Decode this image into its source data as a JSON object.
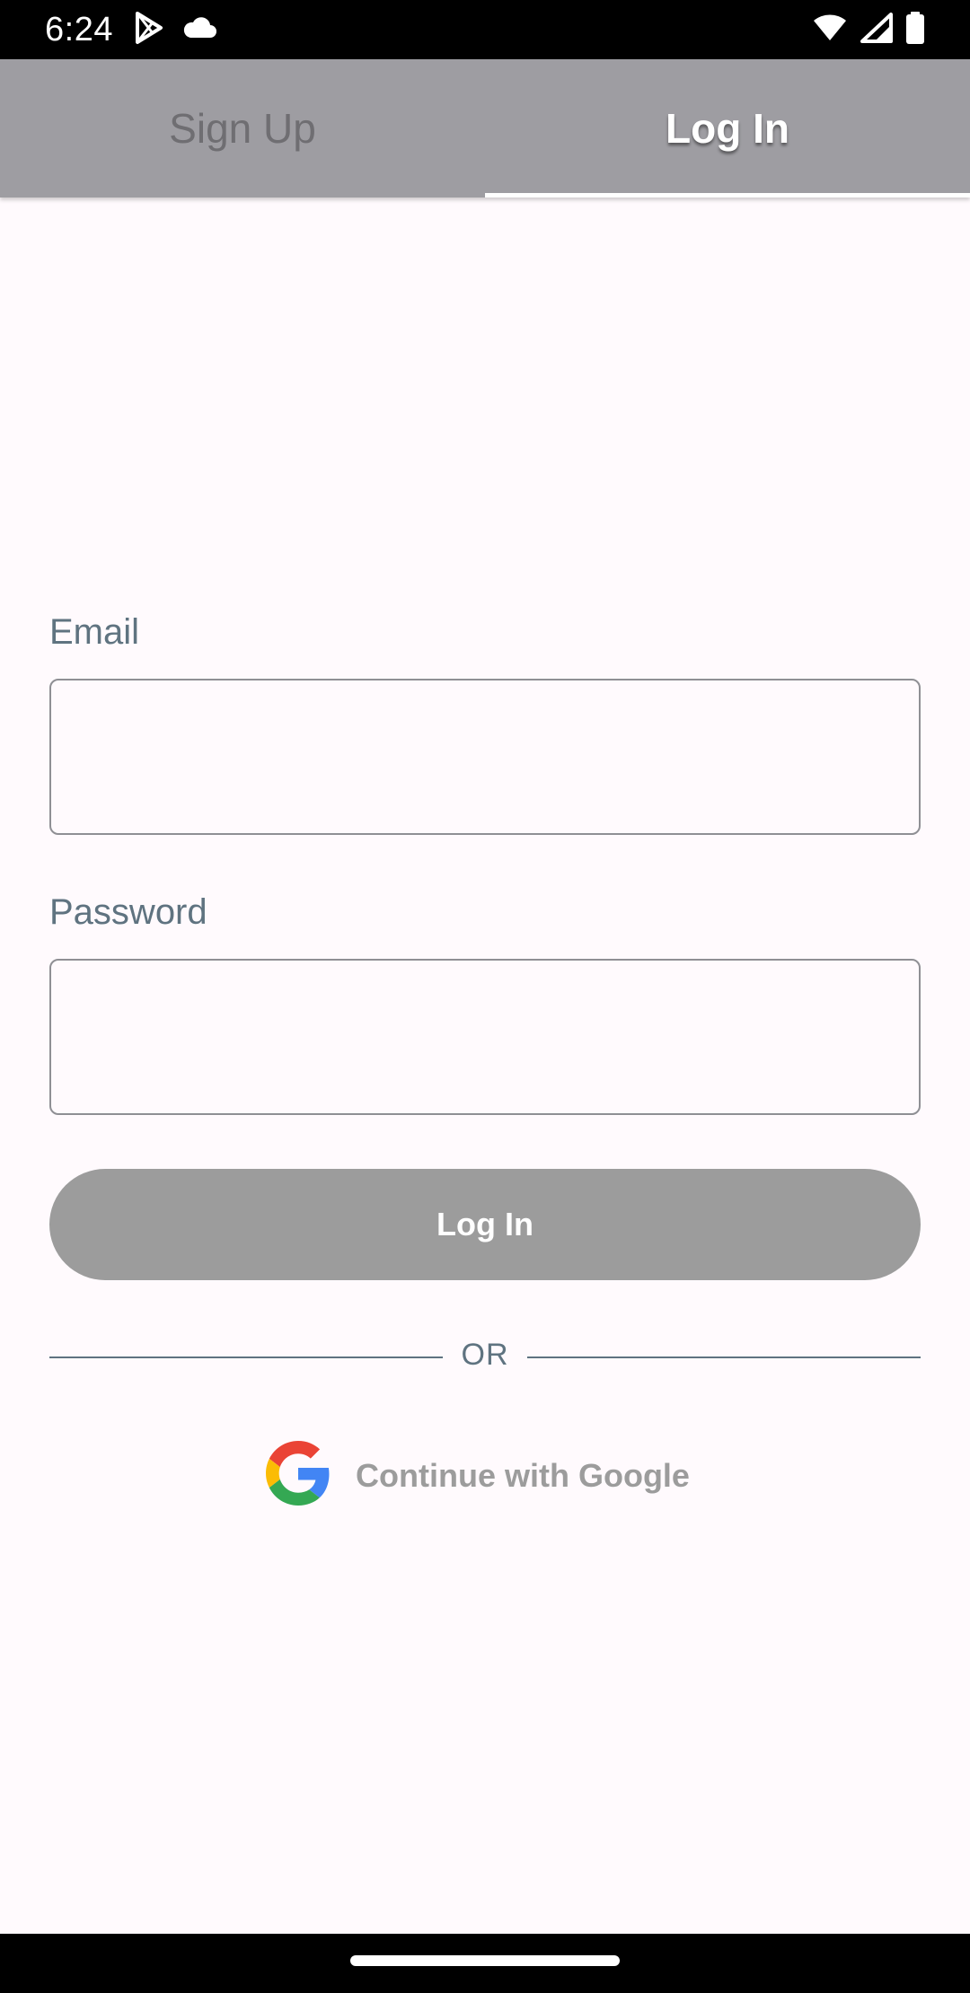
{
  "status_bar": {
    "time": "6:24",
    "left_icons": [
      "play-store-icon",
      "cloud-icon"
    ],
    "right_icons": [
      "wifi-icon",
      "signal-icon",
      "battery-icon"
    ]
  },
  "tabs": [
    {
      "label": "Sign Up",
      "active": false
    },
    {
      "label": "Log In",
      "active": true
    }
  ],
  "form": {
    "email_label": "Email",
    "email_value": "",
    "password_label": "Password",
    "password_value": "",
    "login_button_label": "Log In",
    "divider_text": "OR",
    "google_button_label": "Continue with Google"
  },
  "colors": {
    "tab_bar_bg": "#9e9da2",
    "label_color": "#5f7380",
    "button_disabled": "#9c9c9c"
  }
}
